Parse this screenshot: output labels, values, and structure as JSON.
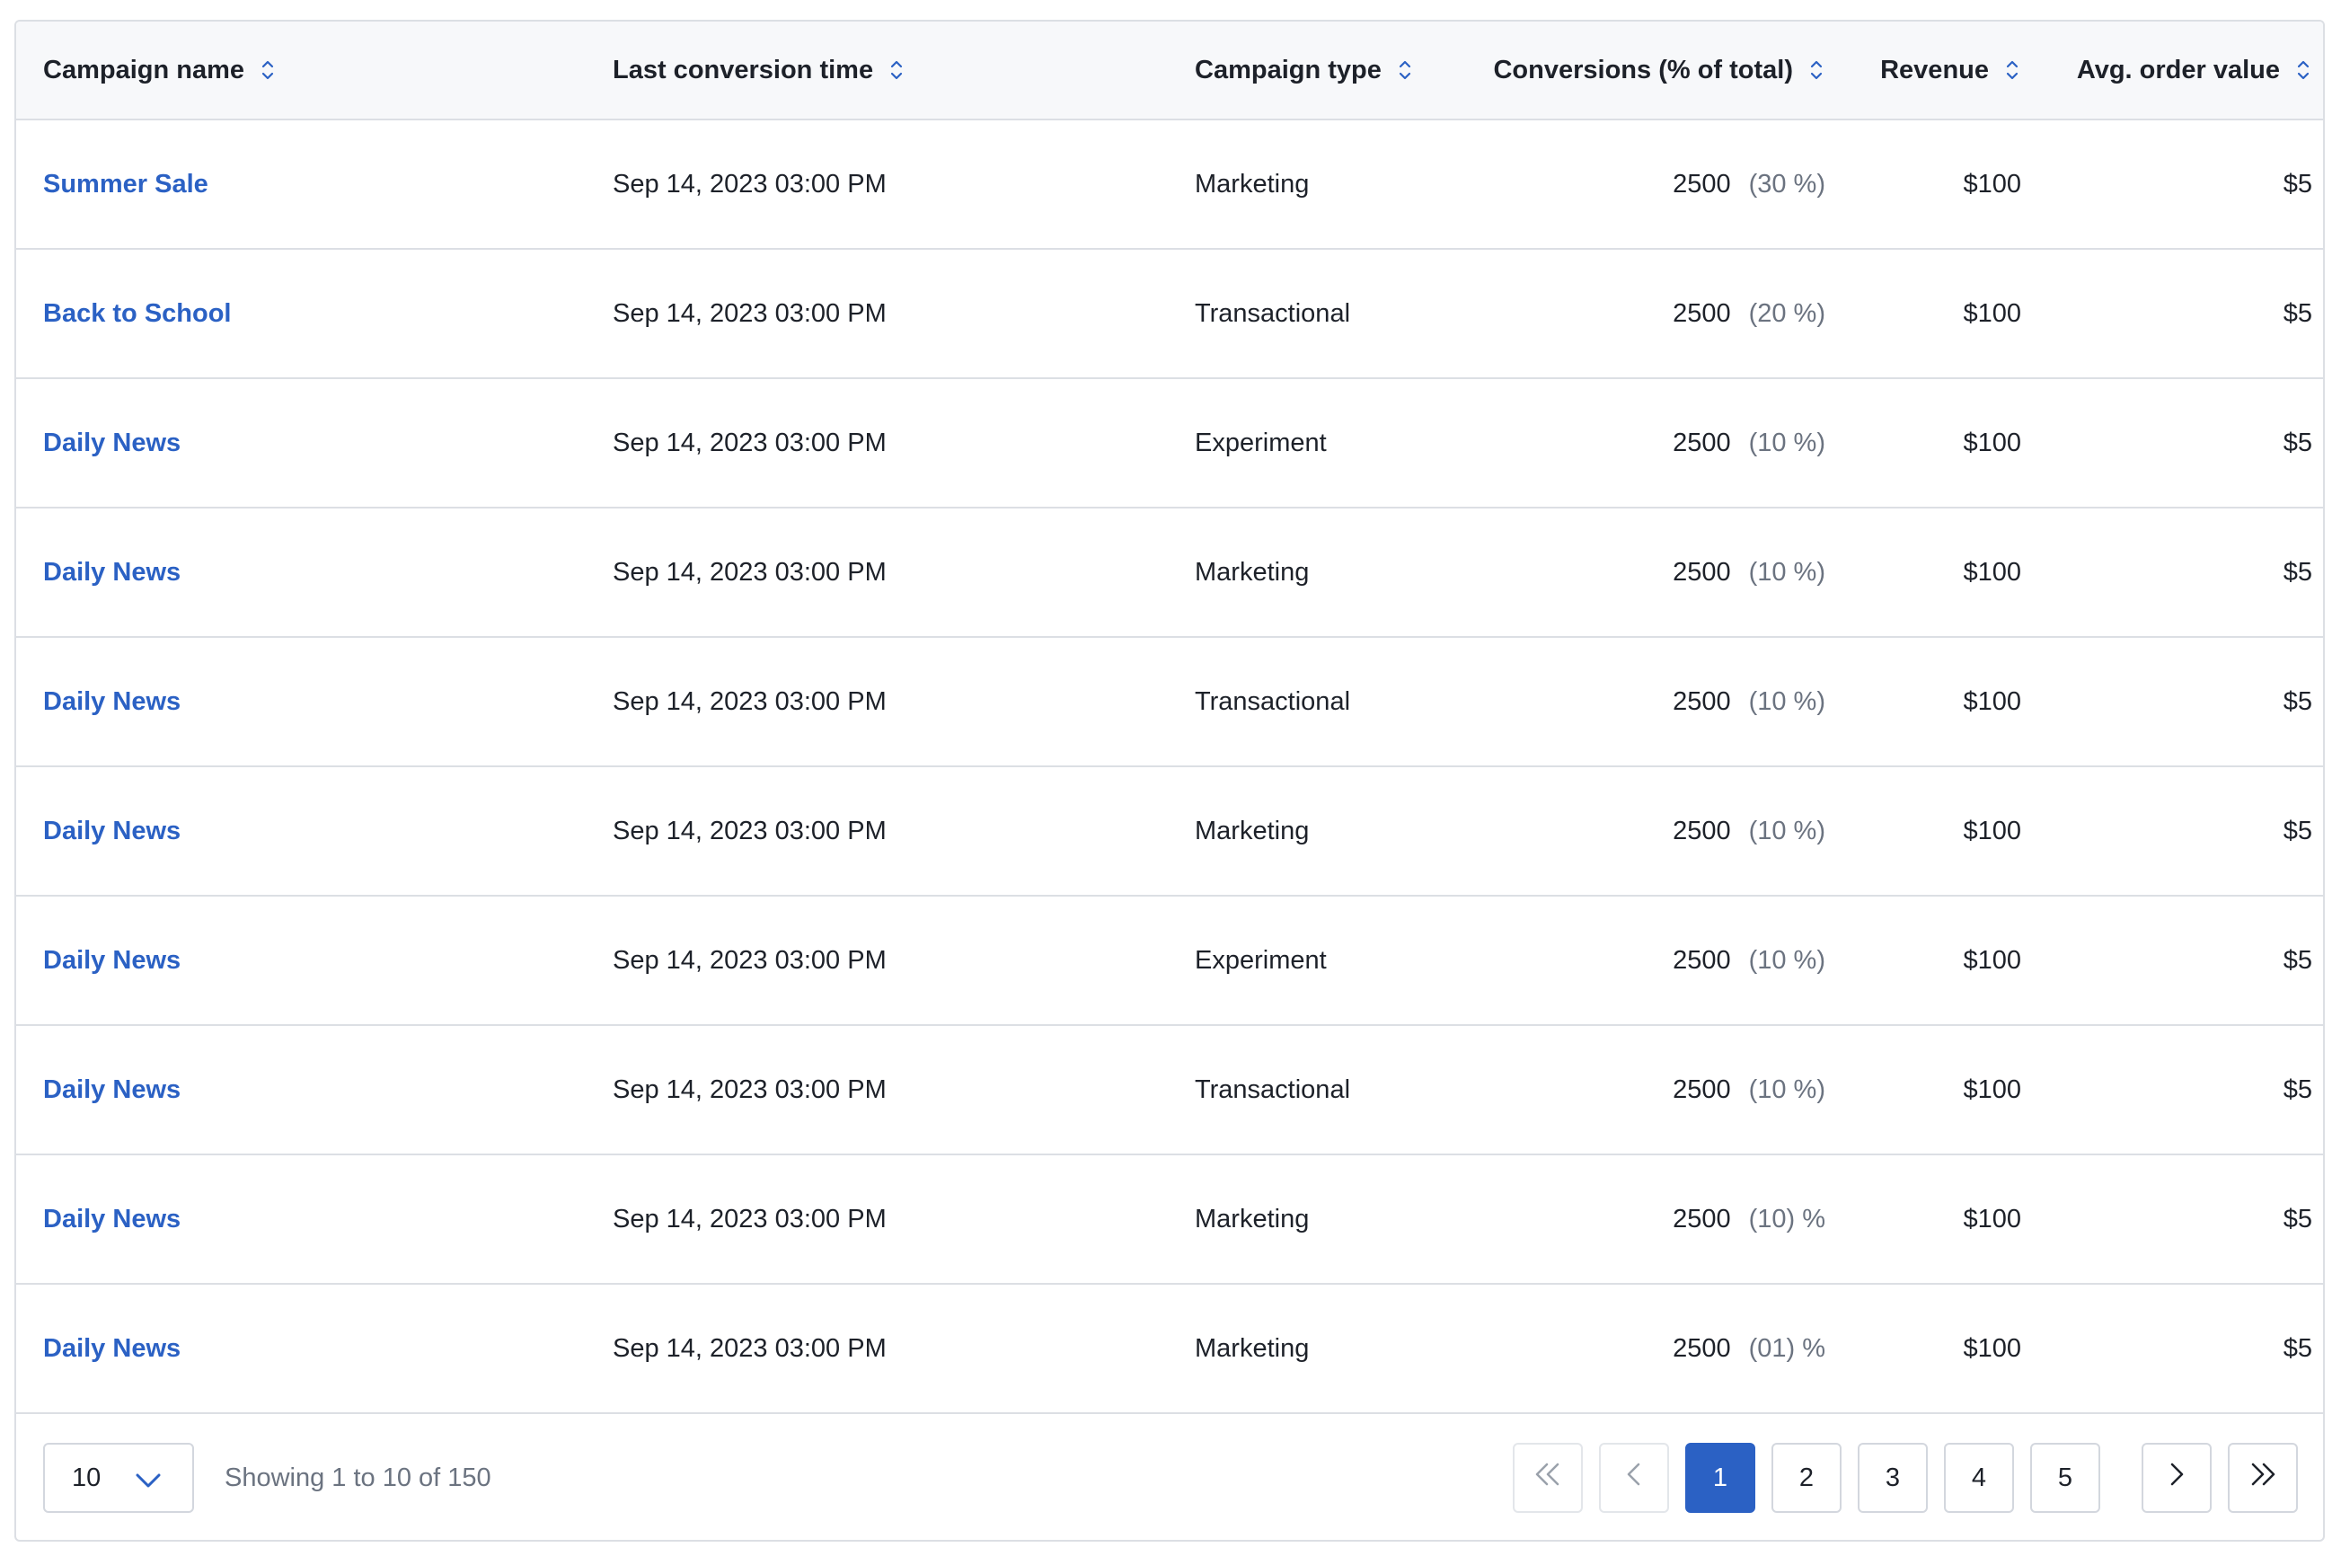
{
  "table": {
    "columns": [
      {
        "label": "Campaign name"
      },
      {
        "label": "Last conversion time"
      },
      {
        "label": "Campaign type"
      },
      {
        "label": "Conversions (% of total)"
      },
      {
        "label": "Revenue"
      },
      {
        "label": "Avg. order value"
      }
    ],
    "rows": [
      {
        "name": "Summer Sale",
        "time": "Sep 14, 2023 03:00 PM",
        "type": "Marketing",
        "conversions": "2500",
        "pct": "(30 %)",
        "revenue": "$100",
        "aov": "$5"
      },
      {
        "name": "Back to School",
        "time": "Sep 14, 2023 03:00 PM",
        "type": "Transactional",
        "conversions": "2500",
        "pct": "(20 %)",
        "revenue": "$100",
        "aov": "$5"
      },
      {
        "name": "Daily News",
        "time": "Sep 14, 2023 03:00 PM",
        "type": "Experiment",
        "conversions": "2500",
        "pct": "(10 %)",
        "revenue": "$100",
        "aov": "$5"
      },
      {
        "name": "Daily News",
        "time": "Sep 14, 2023 03:00 PM",
        "type": "Marketing",
        "conversions": "2500",
        "pct": "(10 %)",
        "revenue": "$100",
        "aov": "$5"
      },
      {
        "name": "Daily News",
        "time": "Sep 14, 2023 03:00 PM",
        "type": "Transactional",
        "conversions": "2500",
        "pct": "(10 %)",
        "revenue": "$100",
        "aov": "$5"
      },
      {
        "name": "Daily News",
        "time": "Sep 14, 2023 03:00 PM",
        "type": "Marketing",
        "conversions": "2500",
        "pct": "(10 %)",
        "revenue": "$100",
        "aov": "$5"
      },
      {
        "name": "Daily News",
        "time": "Sep 14, 2023 03:00 PM",
        "type": "Experiment",
        "conversions": "2500",
        "pct": "(10 %)",
        "revenue": "$100",
        "aov": "$5"
      },
      {
        "name": "Daily News",
        "time": "Sep 14, 2023 03:00 PM",
        "type": "Transactional",
        "conversions": "2500",
        "pct": "(10 %)",
        "revenue": "$100",
        "aov": "$5"
      },
      {
        "name": "Daily News",
        "time": "Sep 14, 2023 03:00 PM",
        "type": "Marketing",
        "conversions": "2500",
        "pct": "(10) %",
        "revenue": "$100",
        "aov": "$5"
      },
      {
        "name": "Daily News",
        "time": "Sep 14, 2023 03:00 PM",
        "type": "Marketing",
        "conversions": "2500",
        "pct": "(01) %",
        "revenue": "$100",
        "aov": "$5"
      }
    ]
  },
  "footer": {
    "page_size": "10",
    "showing": "Showing 1 to 10 of 150",
    "pages": [
      "1",
      "2",
      "3",
      "4",
      "5"
    ],
    "current_page": "1"
  },
  "icons": {
    "sort": "sort-icon",
    "page_size_chevron": "chevron-down-icon",
    "first": "double-chevron-left-icon",
    "prev": "chevron-left-icon",
    "next": "chevron-right-icon",
    "last": "double-chevron-right-icon"
  },
  "colors": {
    "link": "#2b61c4",
    "active_page": "#2b61c4",
    "muted": "#6b7380",
    "border": "#dcdfe4",
    "header_bg": "#f7f8fa"
  }
}
